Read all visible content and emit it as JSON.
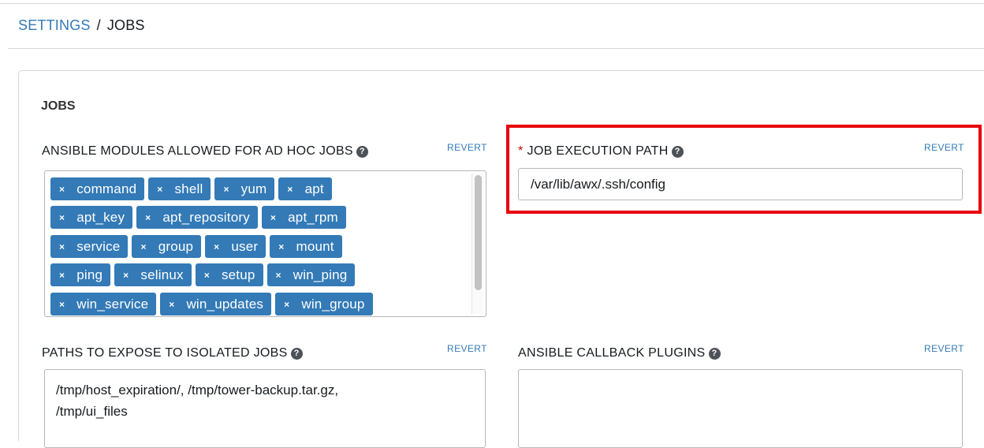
{
  "breadcrumb": {
    "parent": "SETTINGS",
    "separator": "/",
    "current": "JOBS"
  },
  "section": {
    "title": "JOBS"
  },
  "fields": {
    "ansible_modules": {
      "label": "ANSIBLE MODULES ALLOWED FOR AD HOC JOBS",
      "revert": "REVERT",
      "tags": [
        [
          "command",
          "shell",
          "yum",
          "apt"
        ],
        [
          "apt_key",
          "apt_repository",
          "apt_rpm"
        ],
        [
          "service",
          "group",
          "user",
          "mount"
        ],
        [
          "ping",
          "selinux",
          "setup",
          "win_ping"
        ],
        [
          "win_service",
          "win_updates",
          "win_group"
        ]
      ],
      "remove_glyph": "×"
    },
    "job_execution_path": {
      "required_marker": "*",
      "label": "JOB EXECUTION PATH",
      "revert": "REVERT",
      "value": "/var/lib/awx/.ssh/config"
    },
    "paths_to_expose": {
      "label": "PATHS TO EXPOSE TO ISOLATED JOBS",
      "revert": "REVERT",
      "value_lines": [
        "/tmp/host_expiration/, /tmp/tower-backup.tar.gz,",
        "/tmp/ui_files"
      ]
    },
    "callback_plugins": {
      "label": "ANSIBLE CALLBACK PLUGINS",
      "revert": "REVERT",
      "value": ""
    }
  },
  "icons": {
    "help": "question-circle-icon",
    "remove": "close-icon"
  },
  "colors": {
    "link": "#337ab7",
    "tag_bg": "#337ab7",
    "highlight": "#e8000b",
    "required": "#cc0000"
  }
}
